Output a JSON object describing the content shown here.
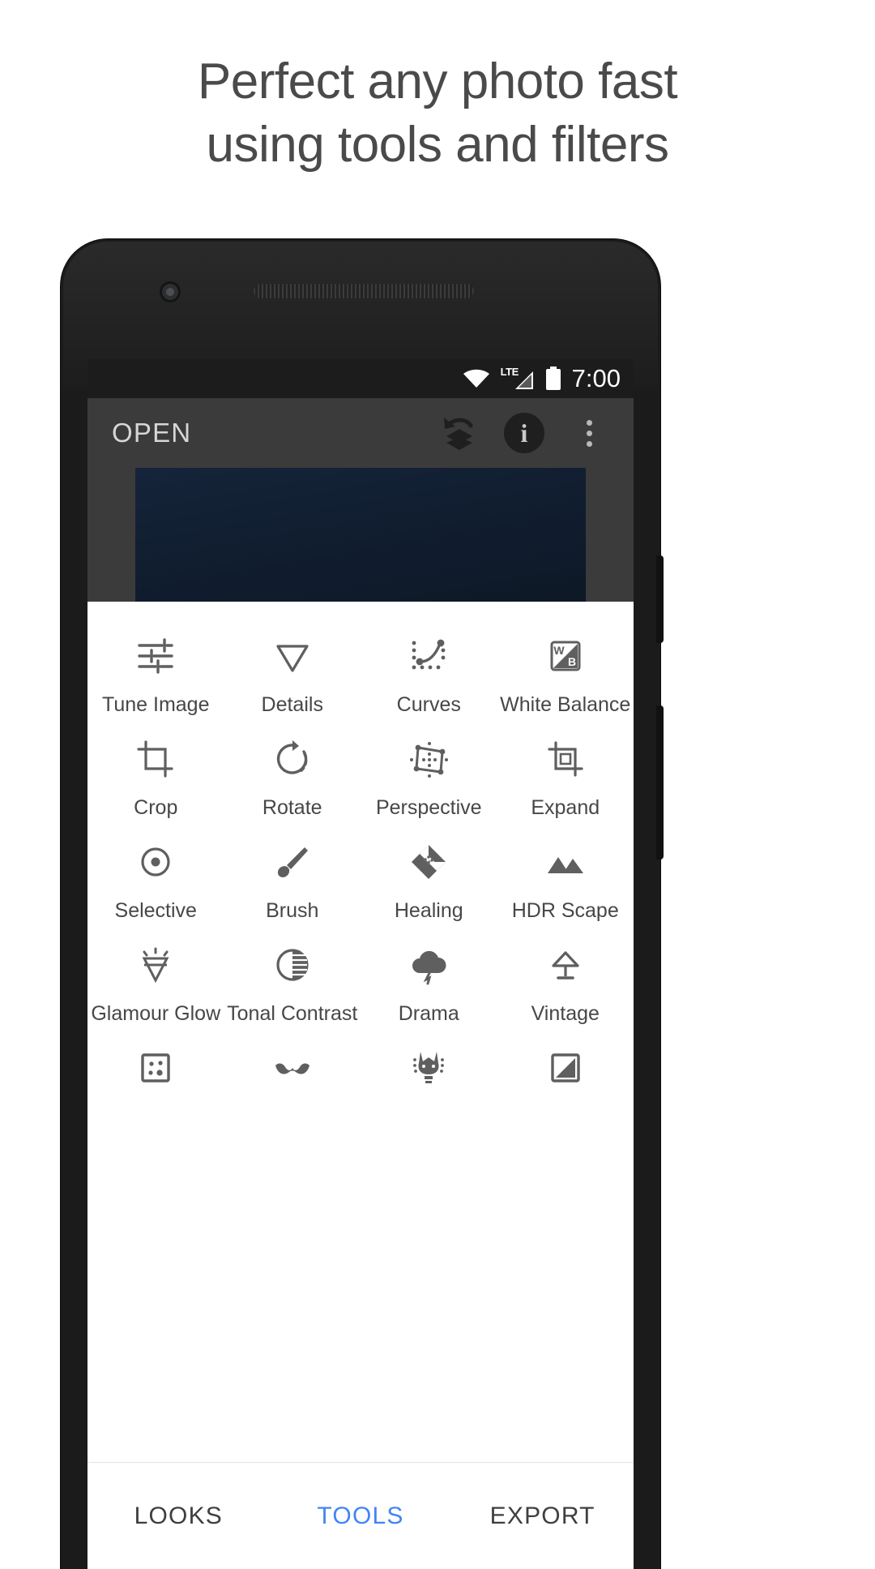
{
  "headline": {
    "line1": "Perfect any photo fast",
    "line2": "using tools and filters"
  },
  "colors": {
    "accent": "#4285f4",
    "phone_body": "#1b1b1b",
    "toolbar": "#3b3b3b",
    "statusbar": "#1c1c1c",
    "photo": "#15243a",
    "label": "#474747"
  },
  "status_bar": {
    "wifi_icon": "wifi-icon",
    "network_label": "LTE",
    "signal_icon": "signal-bars-icon",
    "battery_icon": "battery-full-icon",
    "clock": "7:00"
  },
  "app_toolbar": {
    "open_label": "OPEN",
    "undo_layers_icon": "undo-layers-icon",
    "info_icon": "info-icon",
    "info_glyph": "i",
    "overflow_icon": "overflow-menu-icon"
  },
  "tools": {
    "rows": [
      [
        {
          "label": "Tune Image",
          "icon": "sliders-icon"
        },
        {
          "label": "Details",
          "icon": "triangle-down-icon"
        },
        {
          "label": "Curves",
          "icon": "curves-icon"
        },
        {
          "label": "White Balance",
          "icon": "white-balance-icon",
          "glyph_top": "W",
          "glyph_bottom": "B"
        }
      ],
      [
        {
          "label": "Crop",
          "icon": "crop-icon"
        },
        {
          "label": "Rotate",
          "icon": "rotate-icon"
        },
        {
          "label": "Perspective",
          "icon": "perspective-icon"
        },
        {
          "label": "Expand",
          "icon": "expand-icon"
        }
      ],
      [
        {
          "label": "Selective",
          "icon": "selective-icon"
        },
        {
          "label": "Brush",
          "icon": "brush-icon"
        },
        {
          "label": "Healing",
          "icon": "healing-icon"
        },
        {
          "label": "HDR Scape",
          "icon": "hdr-scape-icon"
        }
      ],
      [
        {
          "label": "Glamour Glow",
          "icon": "glamour-glow-icon"
        },
        {
          "label": "Tonal Contrast",
          "icon": "tonal-contrast-icon"
        },
        {
          "label": "Drama",
          "icon": "drama-icon"
        },
        {
          "label": "Vintage",
          "icon": "vintage-icon"
        }
      ],
      [
        {
          "label": "",
          "icon": "grainy-film-icon"
        },
        {
          "label": "",
          "icon": "retrolux-icon"
        },
        {
          "label": "",
          "icon": "grunge-icon"
        },
        {
          "label": "",
          "icon": "frames-icon"
        }
      ]
    ]
  },
  "tabs": [
    {
      "label": "LOOKS",
      "active": false
    },
    {
      "label": "TOOLS",
      "active": true
    },
    {
      "label": "EXPORT",
      "active": false
    }
  ]
}
